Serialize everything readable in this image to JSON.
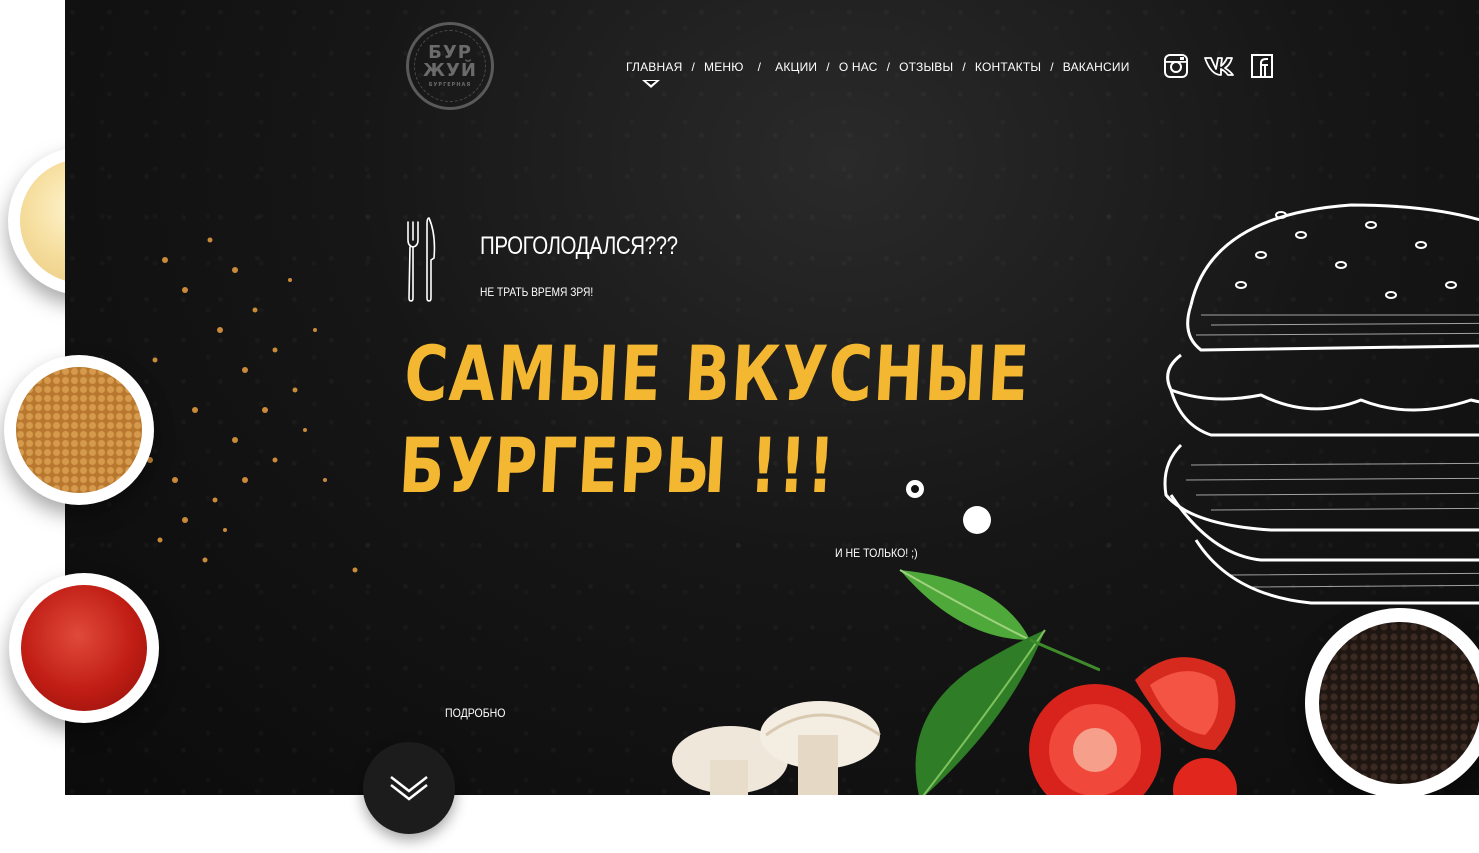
{
  "brand": {
    "logo_line1": "БУР",
    "logo_line2": "ЖУЙ",
    "logo_sub": "БУРГЕРНАЯ"
  },
  "nav": {
    "items": [
      {
        "label": "ГЛАВНАЯ",
        "active": true
      },
      {
        "label": "МЕНЮ",
        "active": false
      },
      {
        "label": "АКЦИИ",
        "active": false
      },
      {
        "label": "О НАС",
        "active": false
      },
      {
        "label": "ОТЗЫВЫ",
        "active": false
      },
      {
        "label": "КОНТАКТЫ",
        "active": false
      },
      {
        "label": "ВАКАНСИИ",
        "active": false
      }
    ],
    "separator": "/"
  },
  "social": {
    "icons": [
      "instagram-icon",
      "vk-icon",
      "facebook-icon"
    ]
  },
  "hero": {
    "question": "ПРОГОЛОДАЛСЯ???",
    "subtitle": "НЕ ТРАТЬ ВРЕМЯ ЗРЯ!",
    "headline_line1": "САМЫЕ ВКУСНЫЕ",
    "headline_line2": "БУРГЕРЫ !!!",
    "note": "И НЕ ТОЛЬКО! ;)",
    "details_label": "ПОДРОБНО"
  },
  "colors": {
    "accent": "#f4b731",
    "background": "#131313",
    "text": "#ffffff"
  }
}
